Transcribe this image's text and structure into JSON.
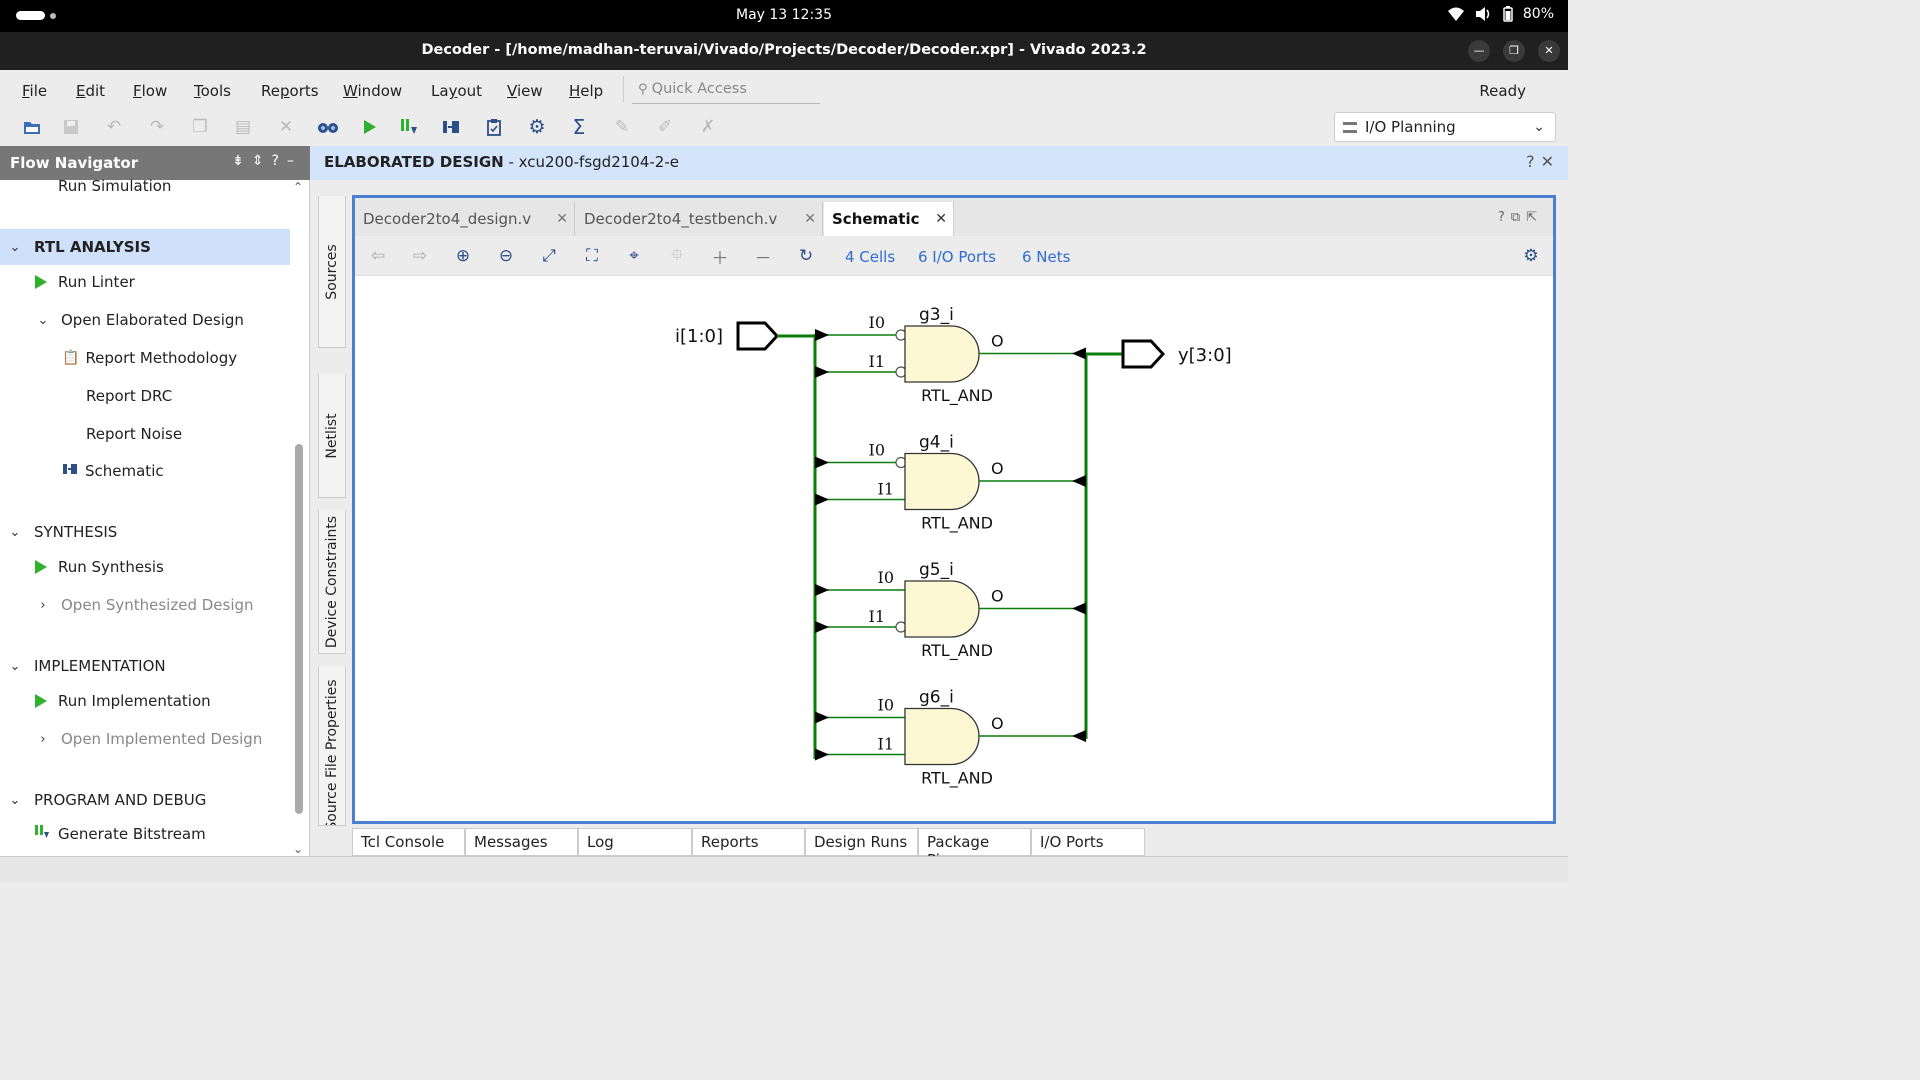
{
  "system": {
    "datetime": "May 13  12:35",
    "battery": "80%"
  },
  "window": {
    "title": "Decoder - [/home/madhan-teruvai/Vivado/Projects/Decoder/Decoder.xpr] - Vivado 2023.2"
  },
  "menu": {
    "items": [
      {
        "label": "File",
        "u": "F",
        "rest": "ile"
      },
      {
        "label": "Edit",
        "u": "E",
        "rest": "dit"
      },
      {
        "label": "Flow",
        "u": "F",
        "rest": "low"
      },
      {
        "label": "Tools",
        "u": "T",
        "rest": "ools"
      },
      {
        "label": "Reports",
        "u": "p",
        "pre": "Re",
        "rest": "orts"
      },
      {
        "label": "Window",
        "u": "W",
        "rest": "indow"
      },
      {
        "label": "Layout",
        "u": "y",
        "pre": "La",
        "rest": "out"
      },
      {
        "label": "View",
        "u": "V",
        "rest": "iew"
      },
      {
        "label": "Help",
        "u": "H",
        "rest": "elp"
      }
    ],
    "quick_access_placeholder": "Quick Access",
    "status": "Ready"
  },
  "toolbar": {
    "layout_select": "I/O Planning"
  },
  "flow_navigator": {
    "title": "Flow Navigator",
    "cut_item": "Run Simulation",
    "sections": [
      {
        "label": "RTL ANALYSIS",
        "items": [
          "Run Linter",
          "Open Elaborated Design",
          "Report Methodology",
          "Report DRC",
          "Report Noise",
          "Schematic"
        ]
      },
      {
        "label": "SYNTHESIS",
        "items": [
          "Run Synthesis",
          "Open Synthesized Design"
        ]
      },
      {
        "label": "IMPLEMENTATION",
        "items": [
          "Run Implementation",
          "Open Implemented Design"
        ]
      },
      {
        "label": "PROGRAM AND DEBUG",
        "items": [
          "Generate Bitstream"
        ]
      }
    ]
  },
  "design_header": {
    "title": "ELABORATED DESIGN",
    "part": " - xcu200-fsgd2104-2-e"
  },
  "side_tabs": [
    "Sources",
    "Netlist",
    "Device Constraints",
    "Source File Properties"
  ],
  "editor_tabs": [
    "Decoder2to4_design.v",
    "Decoder2to4_testbench.v",
    "Schematic"
  ],
  "schematic_toolbar": {
    "cells": "4 Cells",
    "io_ports": "6 I/O Ports",
    "nets": "6 Nets"
  },
  "schematic": {
    "input_port": "i[1:0]",
    "output_port": "y[3:0]",
    "gates": [
      {
        "name": "g3_i",
        "type": "RTL_AND",
        "pin0": "I0",
        "pin1": "I1",
        "out": "O",
        "inv0": true,
        "inv1": true
      },
      {
        "name": "g4_i",
        "type": "RTL_AND",
        "pin0": "I0",
        "pin1": "I1",
        "out": "O",
        "inv0": true,
        "inv1": false
      },
      {
        "name": "g5_i",
        "type": "RTL_AND",
        "pin0": "I0",
        "pin1": "I1",
        "out": "O",
        "inv0": false,
        "inv1": true
      },
      {
        "name": "g6_i",
        "type": "RTL_AND",
        "pin0": "I0",
        "pin1": "I1",
        "out": "O",
        "inv0": false,
        "inv1": false
      }
    ],
    "colors": {
      "wire": "#0a7d0a",
      "gate_fill": "#fdf8d3",
      "link": "#2f6bd1"
    }
  },
  "bottom_tabs": [
    "Tcl Console",
    "Messages",
    "Log",
    "Reports",
    "Design Runs",
    "Package Pins",
    "I/O Ports"
  ]
}
